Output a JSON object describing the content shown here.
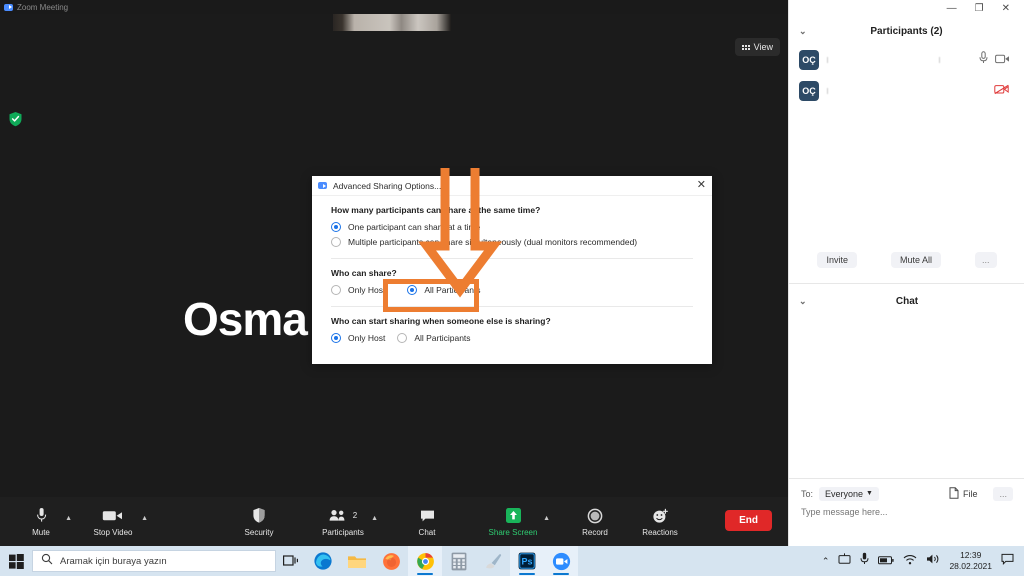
{
  "window": {
    "title": "Zoom Meeting",
    "icon": "zoom-icon",
    "controls": {
      "minimize": "—",
      "maximize": "❐",
      "close": "✕"
    }
  },
  "stage": {
    "speaker_name": "Osma",
    "view_button": {
      "label": "View",
      "icon": "grid-icon"
    },
    "encryption_icon": "green-shield-check-icon"
  },
  "toolbar": {
    "items": [
      {
        "label": "Mute",
        "icon": "microphone-icon",
        "has_caret": true,
        "color": "#e6e6e6"
      },
      {
        "label": "Stop Video",
        "icon": "video-camera-icon",
        "has_caret": true,
        "color": "#e6e6e6"
      },
      {
        "label": "Security",
        "icon": "shield-icon",
        "has_caret": false,
        "color": "#e6e6e6"
      },
      {
        "label": "Participants",
        "icon": "people-icon",
        "has_caret": true,
        "color": "#e6e6e6",
        "badge": "2"
      },
      {
        "label": "Chat",
        "icon": "chat-bubble-icon",
        "has_caret": false,
        "color": "#e6e6e6"
      },
      {
        "label": "Share Screen",
        "icon": "share-screen-icon",
        "has_caret": true,
        "color": "#2ecc71"
      },
      {
        "label": "Record",
        "icon": "record-circle-icon",
        "has_caret": false,
        "color": "#e6e6e6"
      },
      {
        "label": "Reactions",
        "icon": "smiley-plus-icon",
        "has_caret": false,
        "color": "#e6e6e6"
      }
    ],
    "end_button": {
      "label": "End",
      "color": "#e02828"
    }
  },
  "participants_panel": {
    "title": "Participants (2)",
    "collapse_icon": "chevron-down-icon",
    "rows": [
      {
        "avatar": "OÇ",
        "name": "",
        "icons": [
          "microphone-icon",
          "video-camera-icon"
        ],
        "muted_video": false
      },
      {
        "avatar": "OÇ",
        "name": "",
        "icons": [
          "video-off-icon"
        ],
        "muted_video": true
      }
    ],
    "actions": [
      {
        "label": "Invite"
      },
      {
        "label": "Mute All"
      },
      {
        "label": "..."
      }
    ]
  },
  "chat_panel": {
    "title": "Chat",
    "collapse_icon": "chevron-down-icon",
    "to_label": "To:",
    "to_value": "Everyone",
    "file_button": {
      "label": "File",
      "icon": "file-icon"
    },
    "more_button": {
      "label": "..."
    },
    "input_placeholder": "Type message here..."
  },
  "dialog": {
    "title": "Advanced Sharing Options...",
    "icon": "zoom-icon",
    "close_icon": "close-icon",
    "sections": [
      {
        "question": "How many participants can share at the same time?",
        "options": [
          {
            "label": "One participant can share at a time",
            "selected": true
          },
          {
            "label": "Multiple participants can share simultaneously (dual monitors recommended)",
            "selected": false
          }
        ],
        "inline": false
      },
      {
        "question": "Who can share?",
        "options": [
          {
            "label": "Only Host",
            "selected": false
          },
          {
            "label": "All Participants",
            "selected": true
          }
        ],
        "inline": true
      },
      {
        "question": "Who can start sharing when someone else is sharing?",
        "options": [
          {
            "label": "Only Host",
            "selected": true
          },
          {
            "label": "All Participants",
            "selected": false
          }
        ],
        "inline": true
      }
    ]
  },
  "annotations": {
    "color": "#ed7d31",
    "arrow": "down-arrow-pointing-to-all-participants",
    "highlight_box": "all-participants-option"
  },
  "taskbar": {
    "start_icon": "windows-start-icon",
    "search_placeholder": "Aramak için buraya yazın",
    "search_icon": "search-icon",
    "task_view_icon": "task-view-icon",
    "apps": [
      {
        "name": "edge-icon",
        "active": false
      },
      {
        "name": "file-explorer-icon",
        "active": false
      },
      {
        "name": "firefox-icon",
        "active": false
      },
      {
        "name": "chrome-icon",
        "active": true
      },
      {
        "name": "calculator-icon",
        "active": false
      },
      {
        "name": "paint-icon",
        "active": false
      },
      {
        "name": "photoshop-icon",
        "active": true
      },
      {
        "name": "zoom-icon",
        "active": true
      }
    ],
    "tray": [
      "chevron-up-icon",
      "screen-share-icon",
      "microphone-icon",
      "battery-icon",
      "wifi-icon",
      "volume-icon"
    ],
    "clock_time": "12:39",
    "clock_date": "28.02.2021",
    "notification_icon": "notification-icon"
  }
}
